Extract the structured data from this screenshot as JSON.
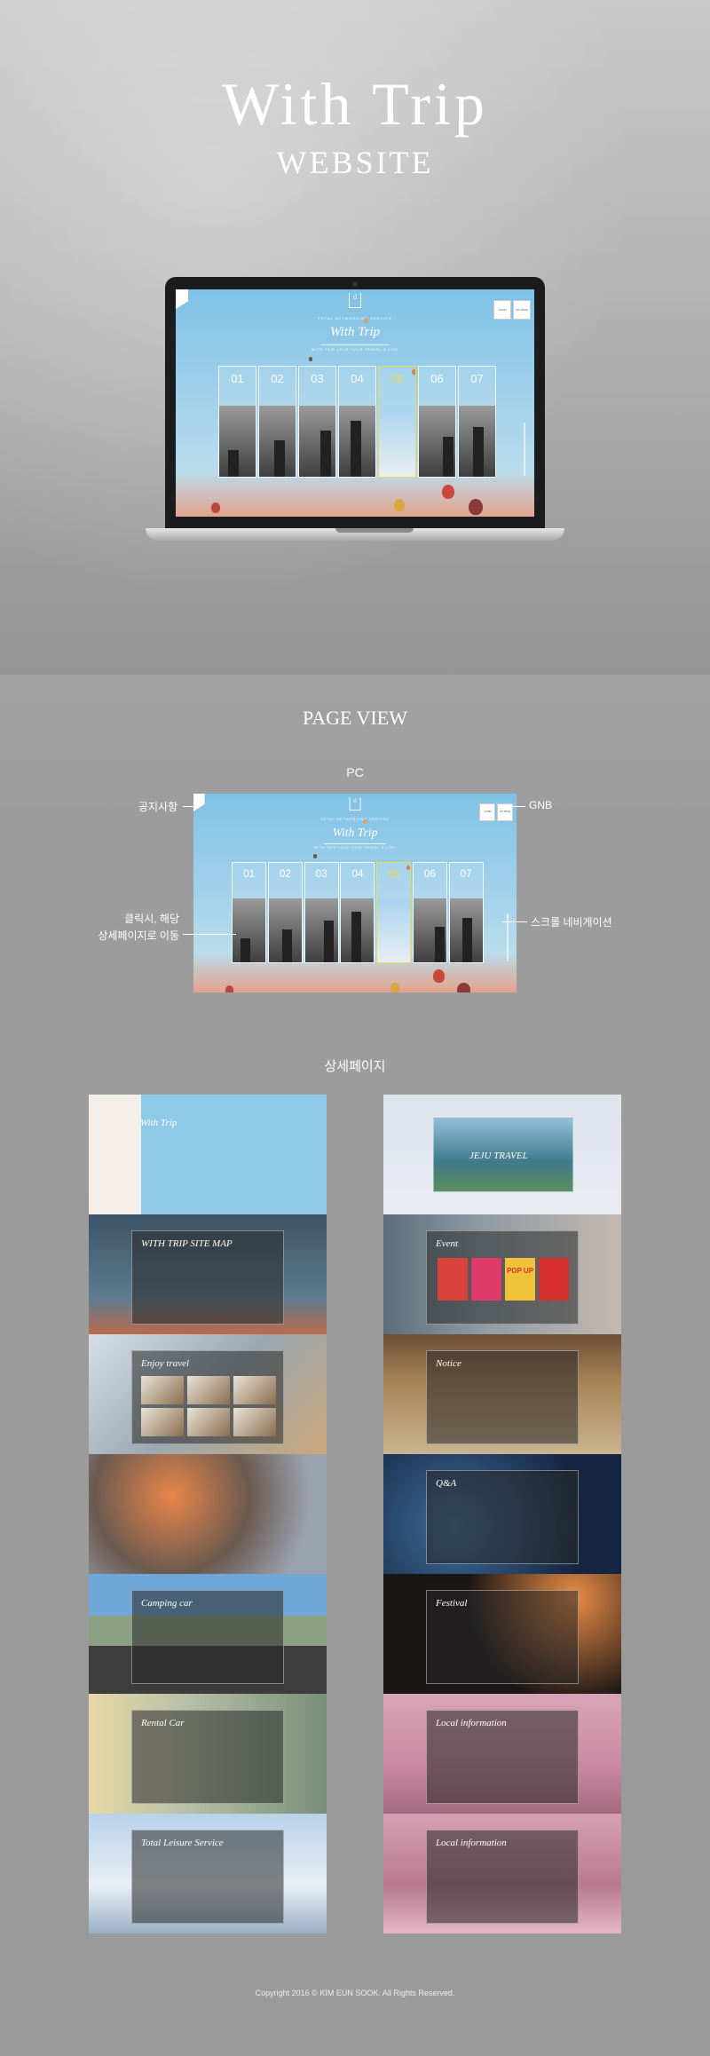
{
  "hero": {
    "title": "With Trip",
    "subtitle": "WEBSITE"
  },
  "site": {
    "kicker": "TOTAL NETWORKING SERVICE",
    "logo_title": "With Trip",
    "tagline": "WITH TRIP LOVE YOUR TRAVEL & LIFE",
    "gnb": [
      "LOGIN",
      "MY PAGE"
    ],
    "tiles": [
      "01",
      "02",
      "03",
      "04",
      "05",
      "06",
      "07"
    ],
    "active_tile": "05",
    "colors": {
      "sky": "#8fc9e8",
      "active": "#f3d64a"
    }
  },
  "page_view": {
    "title": "PAGE VIEW",
    "pc_label": "PC",
    "annotations": {
      "notice": "공지사항",
      "gnb": "GNB",
      "click_line1": "클릭시, 해당",
      "click_line2": "상세페이지로 이동",
      "scroll_nav": "스크롤 네비게이션"
    }
  },
  "detail": {
    "title": "상세페이지",
    "left": [
      {
        "name": "main-notice",
        "label": "With Trip"
      },
      {
        "name": "sitemap",
        "label": "WITH TRIP SITE MAP"
      },
      {
        "name": "enjoy-travel",
        "label": "Enjoy travel"
      },
      {
        "name": "collage",
        "label": ""
      },
      {
        "name": "camping-car",
        "label": "Camping car"
      },
      {
        "name": "rental-car",
        "label": "Rental Car"
      },
      {
        "name": "total-leisure",
        "label": "Total Leisure Service"
      }
    ],
    "right": [
      {
        "name": "jeju",
        "label": "JEJU TRAVEL"
      },
      {
        "name": "event",
        "label": "Event"
      },
      {
        "name": "notice",
        "label": "Notice"
      },
      {
        "name": "qna",
        "label": "Q&A"
      },
      {
        "name": "festival",
        "label": "Festival"
      },
      {
        "name": "local-info-map",
        "label": "Local information"
      },
      {
        "name": "local-info-list",
        "label": "Local information"
      }
    ],
    "event_badge": "POP UP"
  },
  "footer": "Copyright 2016 © KIM EUN SOOK. All Rights Reserved."
}
